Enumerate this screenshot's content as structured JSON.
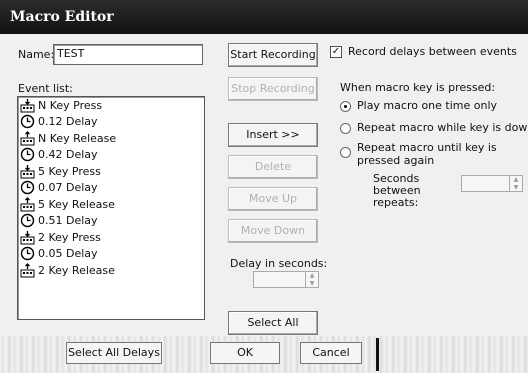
{
  "window": {
    "title": "Macro Editor"
  },
  "name": {
    "label": "Name:",
    "value": "TEST"
  },
  "event_list": {
    "label": "Event list:",
    "items": [
      {
        "text": "N Key Press",
        "icon": "key-press-icon"
      },
      {
        "text": "0.12 Delay",
        "icon": "delay-icon"
      },
      {
        "text": "N Key Release",
        "icon": "key-release-icon"
      },
      {
        "text": "0.42 Delay",
        "icon": "delay-icon"
      },
      {
        "text": "5 Key Press",
        "icon": "key-press-icon"
      },
      {
        "text": "0.07 Delay",
        "icon": "delay-icon"
      },
      {
        "text": "5 Key Release",
        "icon": "key-release-icon"
      },
      {
        "text": "0.51 Delay",
        "icon": "delay-icon"
      },
      {
        "text": "2 Key Press",
        "icon": "key-press-icon"
      },
      {
        "text": "0.05 Delay",
        "icon": "delay-icon"
      },
      {
        "text": "2 Key Release",
        "icon": "key-release-icon"
      }
    ]
  },
  "buttons": {
    "start_recording": "Start Recording",
    "stop_recording": "Stop Recording",
    "insert": "Insert >>",
    "delete": "Delete",
    "move_up": "Move Up",
    "move_down": "Move Down",
    "select_all": "Select All",
    "select_all_delays": "Select All Delays",
    "ok": "OK",
    "cancel": "Cancel"
  },
  "delay": {
    "label": "Delay in seconds:",
    "value": ""
  },
  "options": {
    "record_delays": {
      "label": "Record delays between events",
      "checked": true
    },
    "when_pressed_label": "When macro key is pressed:",
    "play_once": {
      "label": "Play macro one time only",
      "selected": true
    },
    "repeat_while_down": {
      "label": "Repeat macro while key is down",
      "selected": false
    },
    "repeat_until_pressed": {
      "label": "Repeat macro until key is pressed again",
      "selected": false
    },
    "seconds_between": {
      "label": "Seconds between repeats:",
      "value": ""
    }
  }
}
